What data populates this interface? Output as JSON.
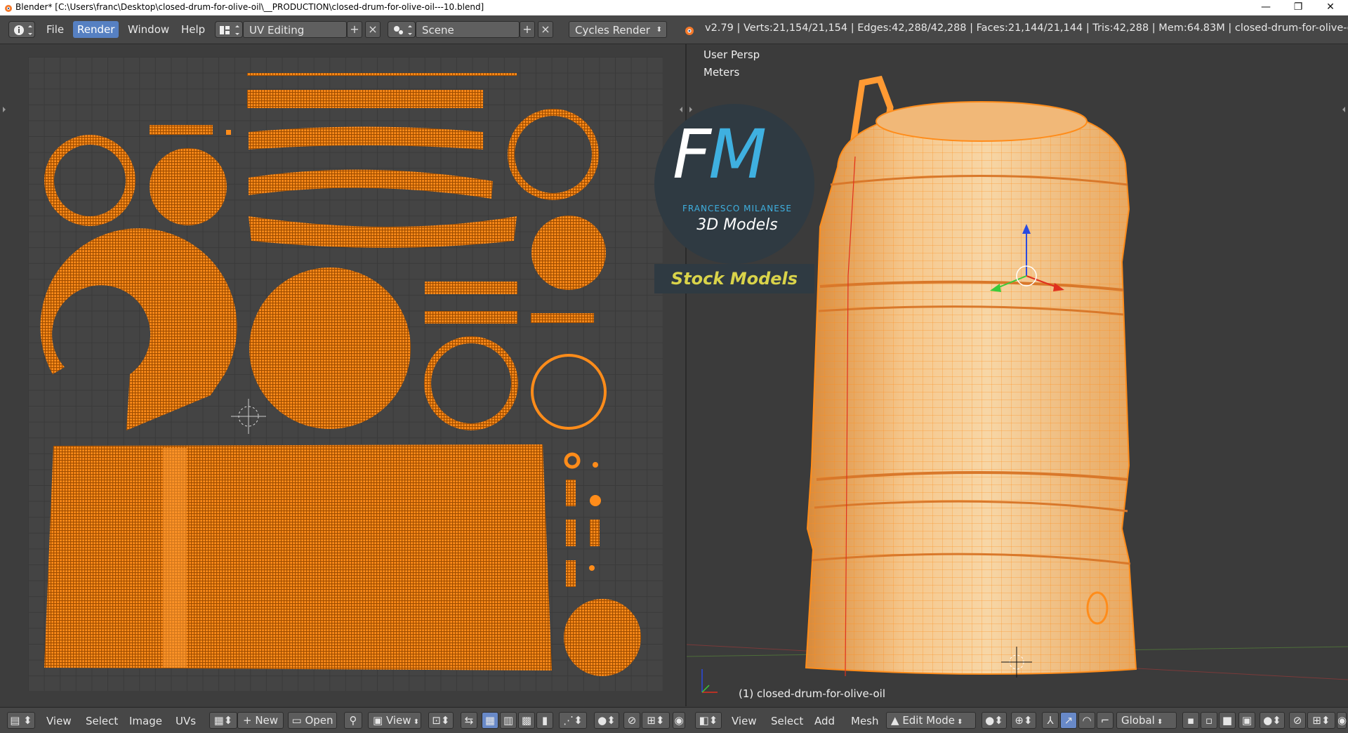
{
  "window": {
    "title": "Blender* [C:\\Users\\franc\\Desktop\\closed-drum-for-olive-oil\\__PRODUCTION\\closed-drum-for-olive-oil---10.blend]",
    "minimize_glyph": "—",
    "maximize_glyph": "❐",
    "close_glyph": "✕"
  },
  "header": {
    "menus": [
      "File",
      "Render",
      "Window",
      "Help"
    ],
    "active_menu": "Render",
    "screen_layout": "UV Editing",
    "scene": "Scene",
    "render_engine": "Cycles Render",
    "stats": "v2.79 | Verts:21,154/21,154 | Edges:42,288/42,288 | Faces:21,144/21,144 | Tris:42,288 | Mem:64.83M | closed-drum-for-olive-oil"
  },
  "viewport": {
    "view_label": "User Persp",
    "units_label": "Meters",
    "object_label": "(1) closed-drum-for-olive-oil"
  },
  "watermark": {
    "initials_f": "F",
    "initials_m": "M",
    "brand": "FRANCESCO MILANESE",
    "tagline": "3D Models",
    "band": "Stock Models"
  },
  "uv_footer": {
    "menus": [
      "View",
      "Select",
      "Image",
      "UVs"
    ],
    "new_label": "New",
    "open_label": "Open",
    "view_label": "View"
  },
  "view3d_footer": {
    "menus": [
      "View",
      "Select",
      "Add",
      "Mesh"
    ],
    "mode": "Edit Mode",
    "orientation": "Global"
  },
  "colors": {
    "accent": "#5680c2",
    "mesh": "#ff8c1a",
    "background": "#393939"
  }
}
